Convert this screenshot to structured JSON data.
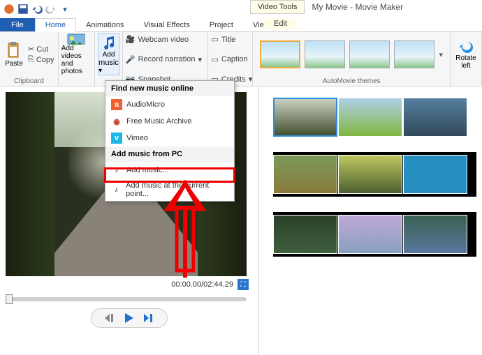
{
  "window": {
    "videoTools": "Video Tools",
    "title": "My Movie - Movie Maker"
  },
  "tabs": {
    "file": "File",
    "home": "Home",
    "anim": "Animations",
    "vfx": "Visual Effects",
    "project": "Project",
    "view": "View",
    "edit": "Edit"
  },
  "ribbon": {
    "clipboard": {
      "label": "Clipboard",
      "paste": "Paste",
      "cut": "Cut",
      "copy": "Copy"
    },
    "add": {
      "label": "Add videos\nand photos",
      "split1": "Add videos",
      "split2": "and photos"
    },
    "music": {
      "label": "Add",
      "label2": "music"
    },
    "rec": {
      "webcam": "Webcam video",
      "narration": "Record narration",
      "snapshot": "Snapshot"
    },
    "titles": {
      "title": "Title",
      "caption": "Caption",
      "credits": "Credits"
    },
    "themes": {
      "label": "AutoMovie themes"
    },
    "rotate": {
      "label": "Rotate",
      "label2": "left"
    }
  },
  "dropdown": {
    "findHeader": "Find new music online",
    "audiomicro": "AudioMicro",
    "fma": "Free Music Archive",
    "vimeo": "Vimeo",
    "pcHeader": "Add music from PC",
    "addMusic": "Add music...",
    "addAtPoint": "Add music at the current point..."
  },
  "player": {
    "time": "00:00.00/02:44.29"
  }
}
